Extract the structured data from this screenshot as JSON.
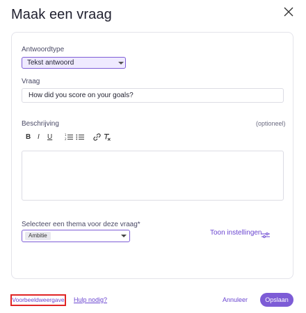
{
  "dialog": {
    "title": "Maak een vraag"
  },
  "form": {
    "answer_type": {
      "label": "Antwoordtype",
      "selected": "Tekst antwoord"
    },
    "question": {
      "label": "Vraag",
      "value": "How did you score on your goals?"
    },
    "description": {
      "label": "Beschrijving",
      "optional_label": "(optioneel)",
      "toolbar": {
        "bold": "B",
        "italic": "I",
        "underline": "U"
      }
    },
    "theme": {
      "label": "Selecteer een thema voor deze vraag*",
      "selected_chip": "Ambitie"
    },
    "settings_link": "Toon instellingen"
  },
  "footer": {
    "preview": "Voorbeeldweergave",
    "help": "Hulp nodig?",
    "cancel": "Annuleer",
    "save": "Opslaan"
  },
  "colors": {
    "accent": "#7d5cd6",
    "link": "#6a45d0",
    "highlight_border": "#e02424"
  }
}
